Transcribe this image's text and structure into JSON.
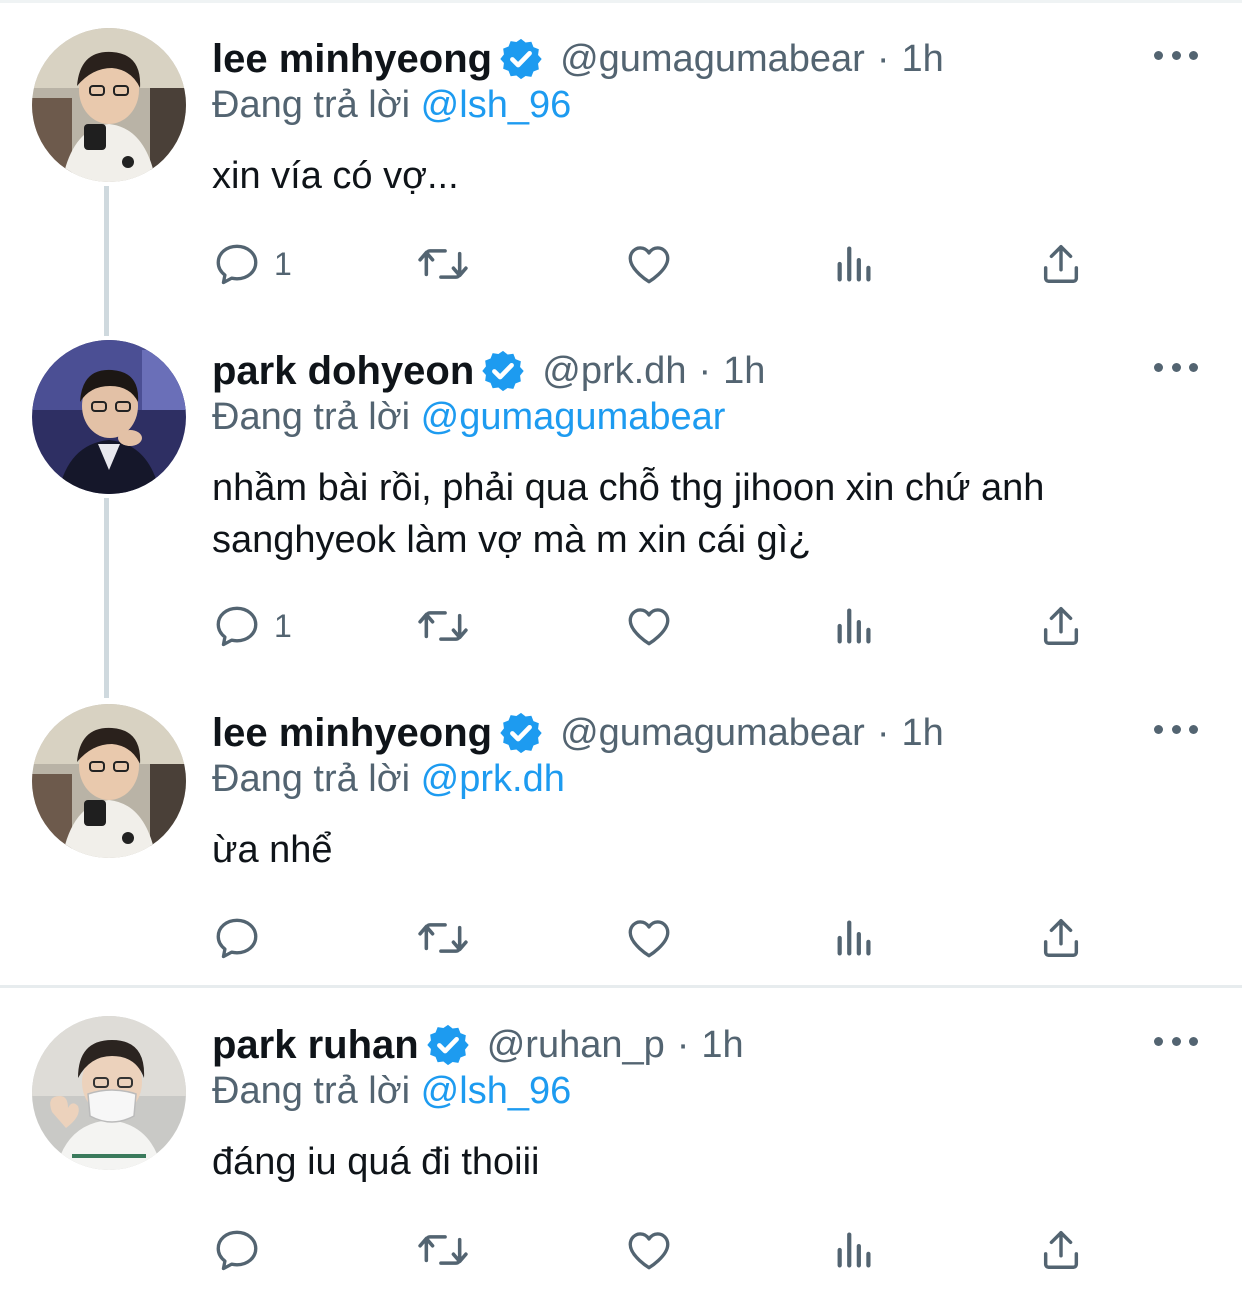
{
  "colors": {
    "text": "#0f1419",
    "secondary": "#536471",
    "accent": "#1d9bf0",
    "thread": "#cfd9de"
  },
  "labels": {
    "replying_to": "Đang trả lời"
  },
  "tweets": [
    {
      "display_name": "lee minhyeong",
      "handle": "@gumagumabear",
      "time": "1h",
      "reply_to": "@lsh_96",
      "text": "xin vía có vợ...",
      "reply_count": "1",
      "icons": [
        "comment-icon",
        "retweet-icon",
        "like-icon",
        "views-icon",
        "share-icon"
      ]
    },
    {
      "display_name": "park dohyeon",
      "handle": "@prk.dh",
      "time": "1h",
      "reply_to": "@gumagumabear",
      "text": "nhầm bài rồi, phải qua chỗ thg jihoon xin chứ anh sanghyeok làm vợ mà m xin cái gì¿",
      "reply_count": "1",
      "icons": [
        "comment-icon",
        "retweet-icon",
        "like-icon",
        "views-icon",
        "share-icon"
      ]
    },
    {
      "display_name": "lee minhyeong",
      "handle": "@gumagumabear",
      "time": "1h",
      "reply_to": "@prk.dh",
      "text": "ừa nhể",
      "reply_count": "",
      "icons": [
        "comment-icon",
        "retweet-icon",
        "like-icon",
        "views-icon",
        "share-icon"
      ]
    },
    {
      "display_name": "park ruhan",
      "handle": "@ruhan_p",
      "time": "1h",
      "reply_to": "@lsh_96",
      "text": "đáng iu quá đi thoiii",
      "reply_count": "",
      "icons": [
        "comment-icon",
        "retweet-icon",
        "like-icon",
        "views-icon",
        "share-icon"
      ]
    }
  ]
}
